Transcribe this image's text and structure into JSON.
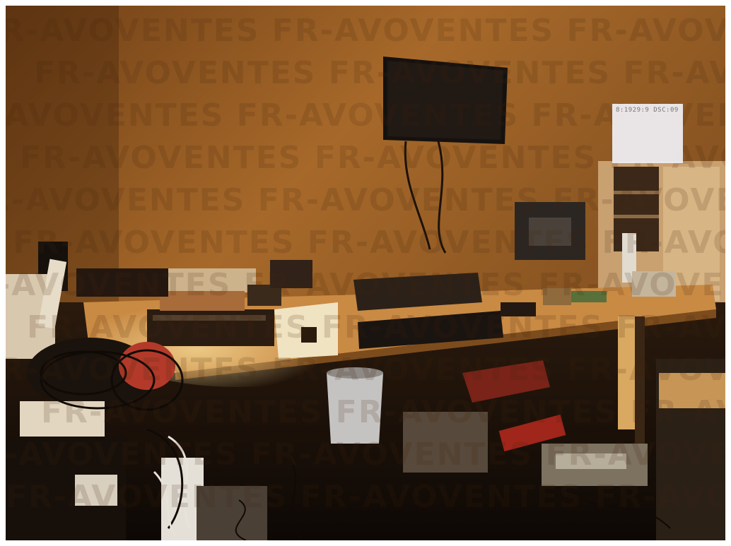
{
  "image": {
    "description_tag": "photo-cluttered-electronics-workbench",
    "watermark_text": "FR-AVOVENTES",
    "corner_label": "8:1929:9 DSC:09",
    "palette": {
      "wall": "#8a5320",
      "wall_light": "#b8762f",
      "desk_top": "#c98a44",
      "shadow": "#1e120a",
      "tv": "#15110f",
      "lamp_glow": "#f2d79a"
    }
  }
}
